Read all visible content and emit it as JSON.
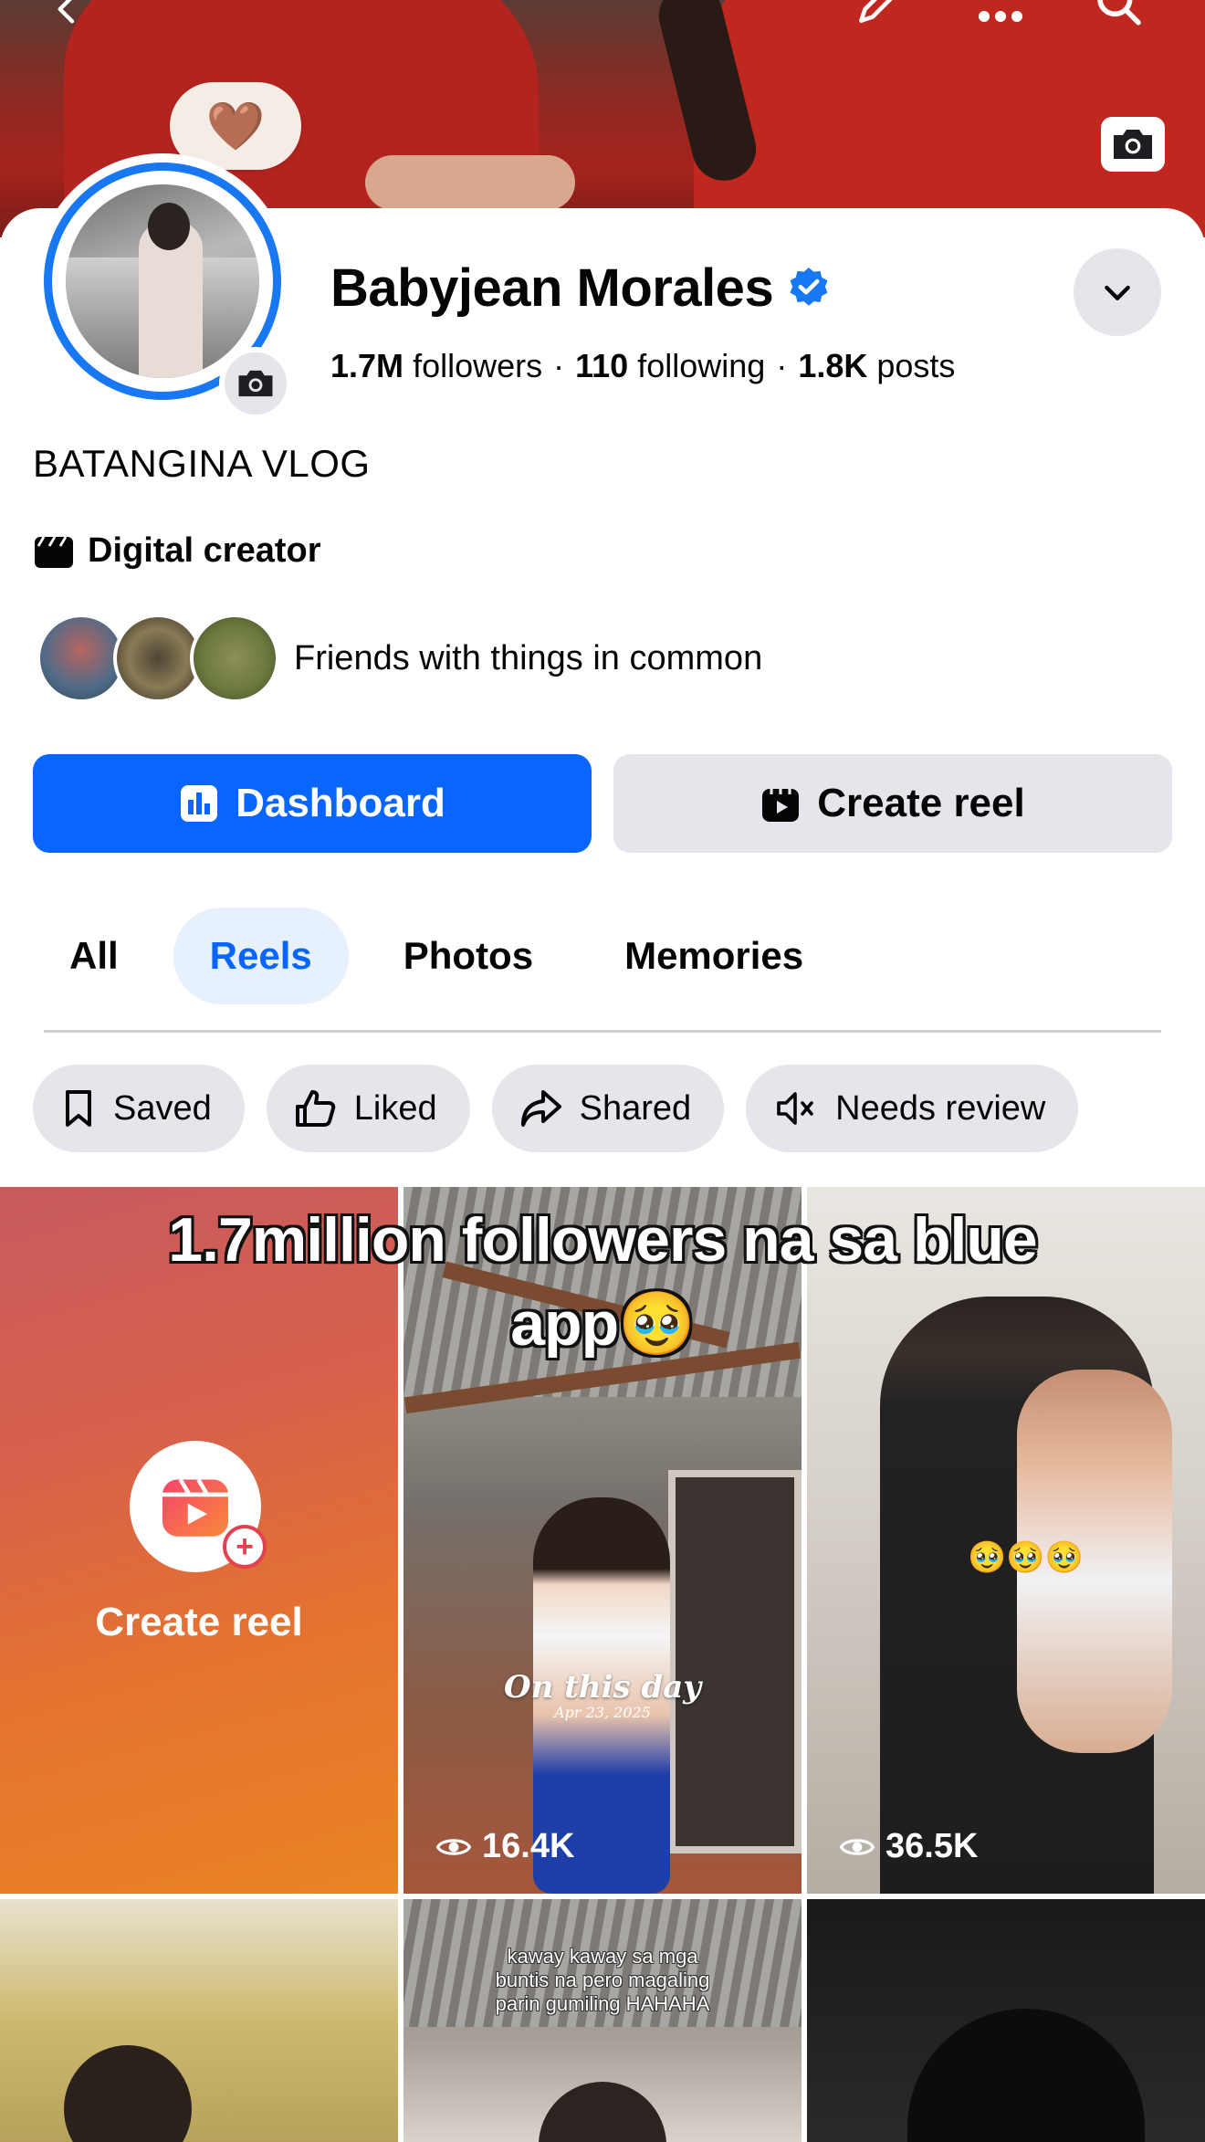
{
  "profile": {
    "note_emoji": "🤎",
    "name": "Babyjean Morales",
    "followers_count": "1.7M",
    "followers_label": "followers",
    "following_count": "110",
    "following_label": "following",
    "posts_count": "1.8K",
    "posts_label": "posts",
    "separator": "·",
    "bio": "BATANGINA VLOG",
    "category": "Digital creator",
    "friends_label": "Friends with things in common"
  },
  "actions": {
    "dashboard_label": "Dashboard",
    "create_reel_label": "Create reel"
  },
  "tabs": [
    {
      "label": "All",
      "active": false
    },
    {
      "label": "Reels",
      "active": true
    },
    {
      "label": "Photos",
      "active": false
    },
    {
      "label": "Memories",
      "active": false
    }
  ],
  "filters": [
    {
      "label": "Saved",
      "icon": "bookmark-icon"
    },
    {
      "label": "Liked",
      "icon": "thumbs-up-icon"
    },
    {
      "label": "Shared",
      "icon": "share-arrow-icon"
    },
    {
      "label": "Needs review",
      "icon": "muted-speaker-icon"
    }
  ],
  "grid": {
    "create_tile_label": "Create reel",
    "caption_line1": "1.7million followers na sa blue",
    "caption_line2": "app🥹",
    "reel2_title": "On this day",
    "reel2_date": "Apr 23, 2025",
    "reel2_views": "16.4K",
    "reel3_emoji": "🥹🥹🥹",
    "reel3_views": "36.5K",
    "reel5_text_line1": "kaway kaway sa mga",
    "reel5_text_line2": "buntis na pero magaling",
    "reel5_text_line3": "parin gumiling HAHAHA"
  },
  "colors": {
    "accent": "#0866ff",
    "verified": "#1877f2",
    "chip_bg": "#e4e6eb",
    "active_tab_bg": "#e7f0fd"
  }
}
